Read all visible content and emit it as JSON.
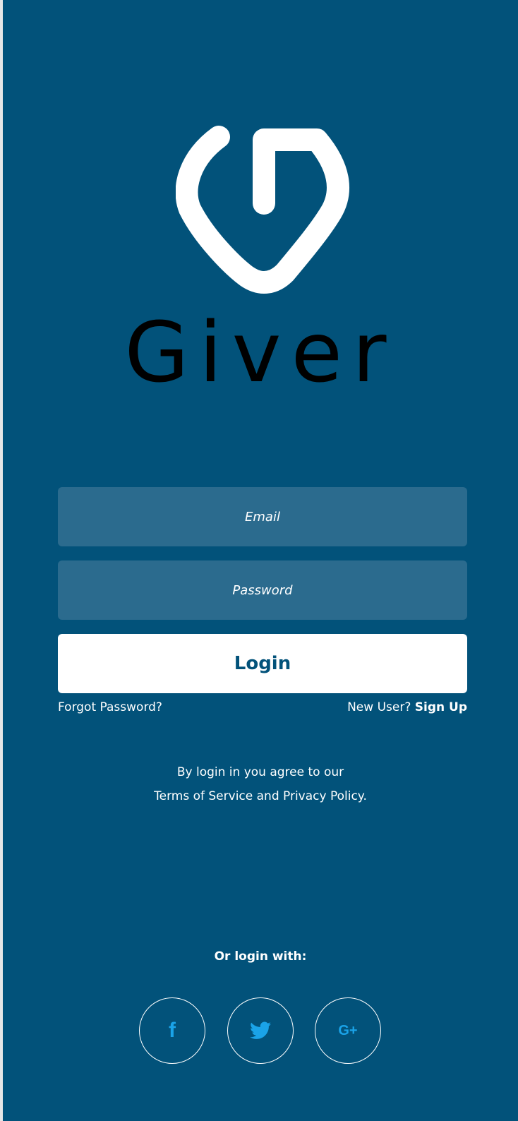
{
  "app": {
    "name": "Giver"
  },
  "form": {
    "email_placeholder": "Email",
    "email_value": "",
    "password_placeholder": "Password",
    "password_value": "",
    "login_label": "Login"
  },
  "links": {
    "forgot_password": "Forgot Password?",
    "new_user": "New User?",
    "sign_up": "Sign Up"
  },
  "terms": {
    "line1": "By login in you agree to our",
    "line2": "Terms of Service and Privacy Policy."
  },
  "social": {
    "heading": "Or login with:",
    "buttons": [
      {
        "name": "facebook",
        "icon": "facebook-icon",
        "glyph": "f"
      },
      {
        "name": "twitter",
        "icon": "twitter-icon",
        "glyph": ""
      },
      {
        "name": "google-plus",
        "icon": "google-plus-icon",
        "glyph": "G+"
      }
    ]
  },
  "colors": {
    "background": "#02527a",
    "field": "#2b6b8e",
    "accent": "#1aa3e8",
    "button": "#ffffff"
  }
}
